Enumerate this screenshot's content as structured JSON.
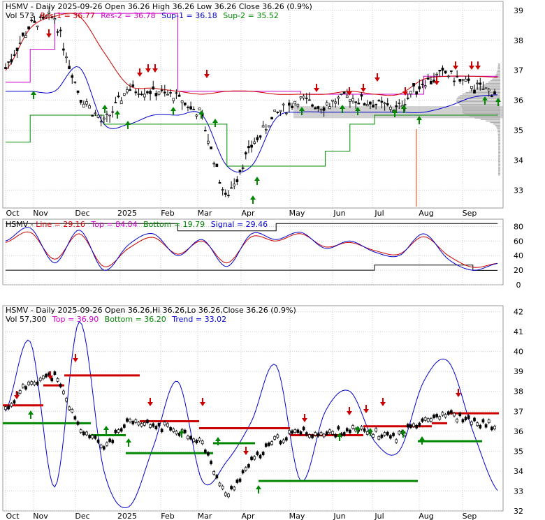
{
  "symbol": "HSMV",
  "colors": {
    "red": "#cc0000",
    "magenta": "#cc00cc",
    "blue": "#0000cc",
    "green": "#008800",
    "black": "#000000",
    "grid": "#cccccc",
    "vp": "#b0b0b0",
    "orange": "#f4a080"
  },
  "panel1": {
    "title": "HSMV - Daily 2025-09-26 Open 36.26  High 36.26  Low 36.26  Close 36.26 (0.9%)",
    "vol": "Vol 573",
    "res1": "Res-1 = 36.77",
    "res2": "Res-2 = 36.78",
    "sup1": "Sup-1 = 36.18",
    "sup2": "Sup-2 = 35.52",
    "yticks": [
      "39",
      "38",
      "37",
      "36",
      "35",
      "34",
      "33"
    ]
  },
  "panel2": {
    "title": "HSMV - ",
    "line": "Line = 29.16",
    "top": "Top = 84.04",
    "bottom": "Bottom = 19.79",
    "signal": "Signal = 29.46",
    "yticks": [
      "80",
      "60",
      "40",
      "20",
      "0"
    ]
  },
  "panel3": {
    "title": "HSMV - Daily 2025-09-26 Open 36.26,Hi 36.26,Lo 36.26,Close 36.26 (0.9%)",
    "vol": "Vol 57,300",
    "top": "Top = 36.90",
    "bottom": "Bottom = 36.20",
    "trend": "Trend = 33.02",
    "yticks": [
      "42",
      "41",
      "40",
      "39",
      "38",
      "37",
      "36",
      "35",
      "34",
      "33",
      "32"
    ]
  },
  "x_labels": [
    "Oct",
    "Nov",
    "Dec",
    "2025",
    "Feb",
    "Mar",
    "Apr",
    "May",
    "Jun",
    "Jul",
    "Aug",
    "Sep"
  ],
  "chart_data": [
    {
      "type": "candlestick",
      "ylim": [
        32.4,
        39.3
      ],
      "x": [
        "Oct",
        "Nov",
        "Dec",
        "2025",
        "Feb",
        "Mar",
        "Apr",
        "May",
        "Jun",
        "Jul",
        "Aug",
        "Sep"
      ],
      "close": [
        37.1,
        38.5,
        38.8,
        36.2,
        35.2,
        36.4,
        36.3,
        36.1,
        35.5,
        32.7,
        34.4,
        35.5,
        36.0,
        35.8,
        36.1,
        35.9,
        35.7,
        36.6,
        36.9,
        36.5,
        36.26
      ],
      "series": [
        {
          "name": "Res-1",
          "values": [
            37.0,
            38.4,
            38.8,
            38.8,
            37.6,
            36.5,
            36.4,
            36.3,
            36.2,
            36.3,
            36.3,
            36.2,
            36.2,
            36.2,
            36.3,
            36.2,
            36.2,
            36.7,
            36.8,
            36.8,
            36.77
          ]
        },
        {
          "name": "Res-2",
          "values": [
            36.6,
            37.7,
            38.9,
            38.9,
            38.9,
            38.9,
            38.9,
            36.3,
            36.3,
            36.3,
            36.3,
            36.3,
            36.2,
            36.2,
            36.2,
            36.2,
            36.2,
            36.8,
            36.8,
            36.8,
            36.78
          ]
        },
        {
          "name": "Sup-1",
          "values": [
            36.3,
            36.3,
            36.3,
            37.1,
            35.2,
            35.2,
            35.5,
            35.5,
            35.5,
            33.8,
            33.8,
            35.4,
            35.6,
            35.6,
            35.6,
            35.6,
            35.6,
            35.6,
            35.8,
            36.1,
            36.18
          ]
        },
        {
          "name": "Sup-2",
          "values": [
            34.6,
            35.5,
            35.5,
            35.5,
            35.2,
            35.2,
            35.2,
            35.2,
            35.2,
            33.8,
            33.8,
            33.8,
            33.8,
            34.3,
            35.2,
            35.5,
            35.5,
            35.5,
            35.5,
            35.5,
            35.52
          ]
        }
      ]
    },
    {
      "type": "line",
      "ylim": [
        0,
        90
      ],
      "series": [
        {
          "name": "Line",
          "values": [
            60,
            78,
            30,
            75,
            20,
            55,
            70,
            40,
            62,
            25,
            70,
            62,
            72,
            50,
            60,
            45,
            40,
            70,
            35,
            20,
            29.16
          ]
        },
        {
          "name": "Signal",
          "values": [
            58,
            72,
            35,
            70,
            25,
            50,
            65,
            42,
            60,
            30,
            66,
            60,
            70,
            52,
            58,
            47,
            42,
            66,
            40,
            24,
            29.46
          ]
        },
        {
          "name": "Top",
          "values": [
            84,
            84,
            84,
            84,
            84,
            84,
            84,
            74,
            74,
            74,
            74,
            84,
            84,
            84,
            84,
            84,
            84,
            84,
            84,
            84,
            84.04
          ]
        },
        {
          "name": "Bottom",
          "values": [
            20,
            20,
            20,
            20,
            20,
            20,
            20,
            20,
            20,
            20,
            20,
            20,
            20,
            20,
            20,
            27,
            27,
            27,
            27,
            19.79,
            19.79
          ]
        }
      ]
    },
    {
      "type": "line",
      "ylim": [
        32,
        42.3
      ],
      "series": [
        {
          "name": "Trend",
          "values": [
            37,
            40.5,
            33.2,
            41.5,
            34,
            32.2,
            35.2,
            38.5,
            33.5,
            34.5,
            36.5,
            39.3,
            33.5,
            37,
            38,
            35.5,
            35,
            38.5,
            39.5,
            36,
            33.02
          ]
        }
      ]
    }
  ]
}
